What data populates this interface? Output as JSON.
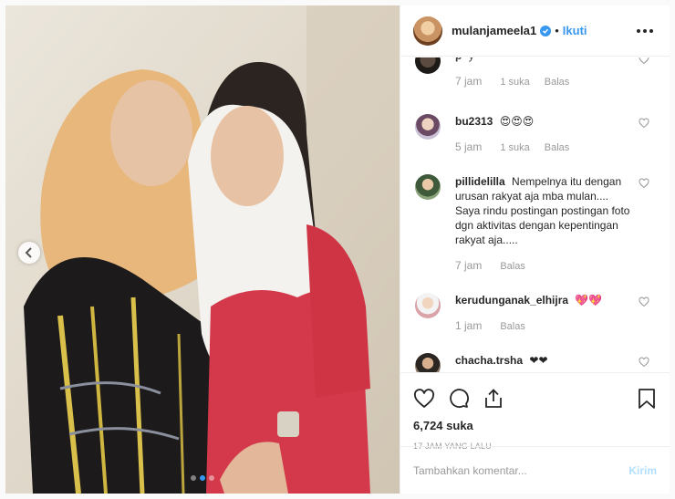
{
  "header": {
    "username": "mulanjameela1",
    "separator": "•",
    "follow_label": "Ikuti"
  },
  "comments": [
    {
      "username": "p",
      "text": "y",
      "time": "7 jam",
      "likes": "1 suka",
      "reply": "Balas"
    },
    {
      "username": "bu2313",
      "text": "😍😍😍",
      "time": "5 jam",
      "likes": "1 suka",
      "reply": "Balas"
    },
    {
      "username": "pillidelilla",
      "text": "Nempelnya itu dengan urusan rakyat aja mba mulan.... Saya rindu postingan postingan foto dgn aktivitas dengan kepentingan rakyat aja.....",
      "time": "7 jam",
      "reply": "Balas"
    },
    {
      "username": "kerudunganak_elhijra",
      "text": "💖💖",
      "time": "1 jam",
      "reply": "Balas"
    },
    {
      "username": "chacha.trsha",
      "text": "❤❤"
    }
  ],
  "post": {
    "likes": "6,724 suka",
    "posted": "17 JAM YANG LALU"
  },
  "add_comment": {
    "placeholder": "Tambahkan komentar...",
    "post_label": "Kirim"
  },
  "carousel": {
    "slide_count": 3,
    "active_slide": 2
  },
  "colors": {
    "accent": "#3897f0",
    "post_disabled": "#b2dffc",
    "muted": "#999999"
  }
}
